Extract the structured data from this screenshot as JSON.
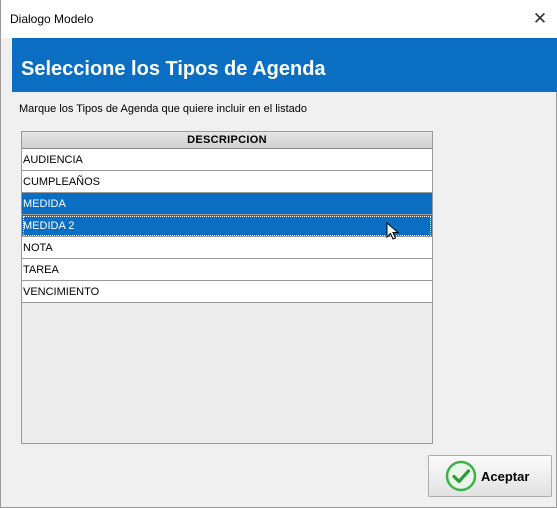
{
  "window": {
    "title": "Dialogo Modelo",
    "close_glyph": "✕"
  },
  "header": {
    "title": "Seleccione los Tipos de Agenda",
    "color": "#0a6fc2"
  },
  "instructions": "Marque los Tipos de Agenda que quiere incluir en el listado",
  "grid": {
    "column_header": "DESCRIPCION",
    "rows": [
      {
        "label": "AUDIENCIA",
        "selected": false
      },
      {
        "label": "CUMPLEAÑOS",
        "selected": false
      },
      {
        "label": "MEDIDA",
        "selected": true
      },
      {
        "label": "MEDIDA 2",
        "selected": true
      },
      {
        "label": "NOTA",
        "selected": false
      },
      {
        "label": "TAREA",
        "selected": false
      },
      {
        "label": "VENCIMIENTO",
        "selected": false
      }
    ]
  },
  "buttons": {
    "accept_label": "Aceptar",
    "accept_icon": "check-circle-icon"
  },
  "colors": {
    "selection": "#0a6fc2",
    "accept_icon_green": "#3fb34a"
  }
}
